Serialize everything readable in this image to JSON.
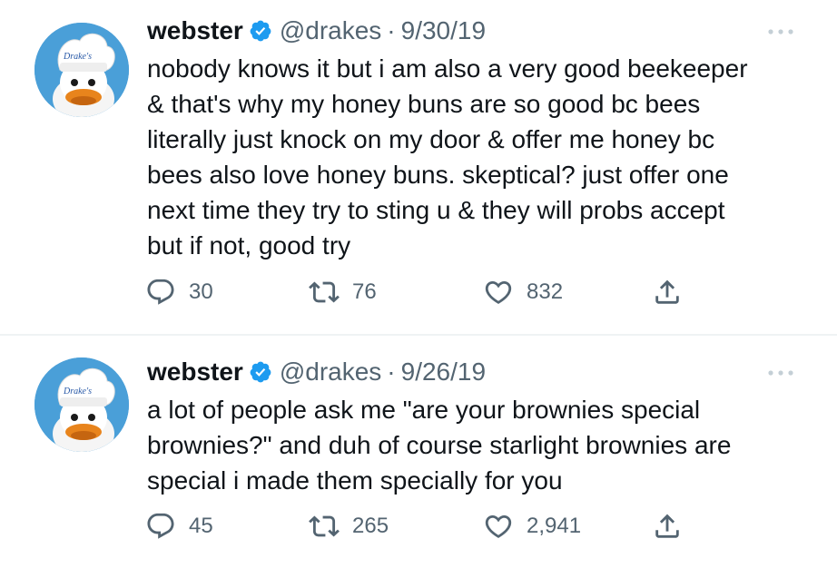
{
  "tweets": [
    {
      "author": {
        "name": "webster",
        "handle": "@drakes",
        "avatar_text": "Drake's"
      },
      "separator": "·",
      "date": "9/30/19",
      "lines": [
        "nobody knows it but i am also a very good beekeeper",
        "& that's why my honey buns are so good bc bees",
        "literally just knock on my door & offer me honey bc",
        "bees also love honey buns. skeptical? just offer one",
        "next time they try to sting u & they will probs accept",
        "but if not, good try"
      ],
      "stats": {
        "replies": "30",
        "retweets": "76",
        "likes": "832"
      }
    },
    {
      "author": {
        "name": "webster",
        "handle": "@drakes",
        "avatar_text": "Drake's"
      },
      "separator": "·",
      "date": "9/26/19",
      "lines": [
        "a lot of people ask me \"are your brownies special",
        "brownies?\" and duh of course starlight brownies are",
        "special i made them specially for you"
      ],
      "stats": {
        "replies": "45",
        "retweets": "265",
        "likes": "2,941"
      }
    }
  ],
  "icons": {
    "verified": "verified-badge-icon",
    "more": "more-options-icon",
    "reply": "reply-icon",
    "retweet": "retweet-icon",
    "like": "heart-icon",
    "share": "share-icon"
  },
  "colors": {
    "verified": "#1d9bf0",
    "icon_gray": "#536471",
    "text": "#0f1419",
    "avatar_bg": "#4a9fd8",
    "beak": "#e8841c"
  }
}
